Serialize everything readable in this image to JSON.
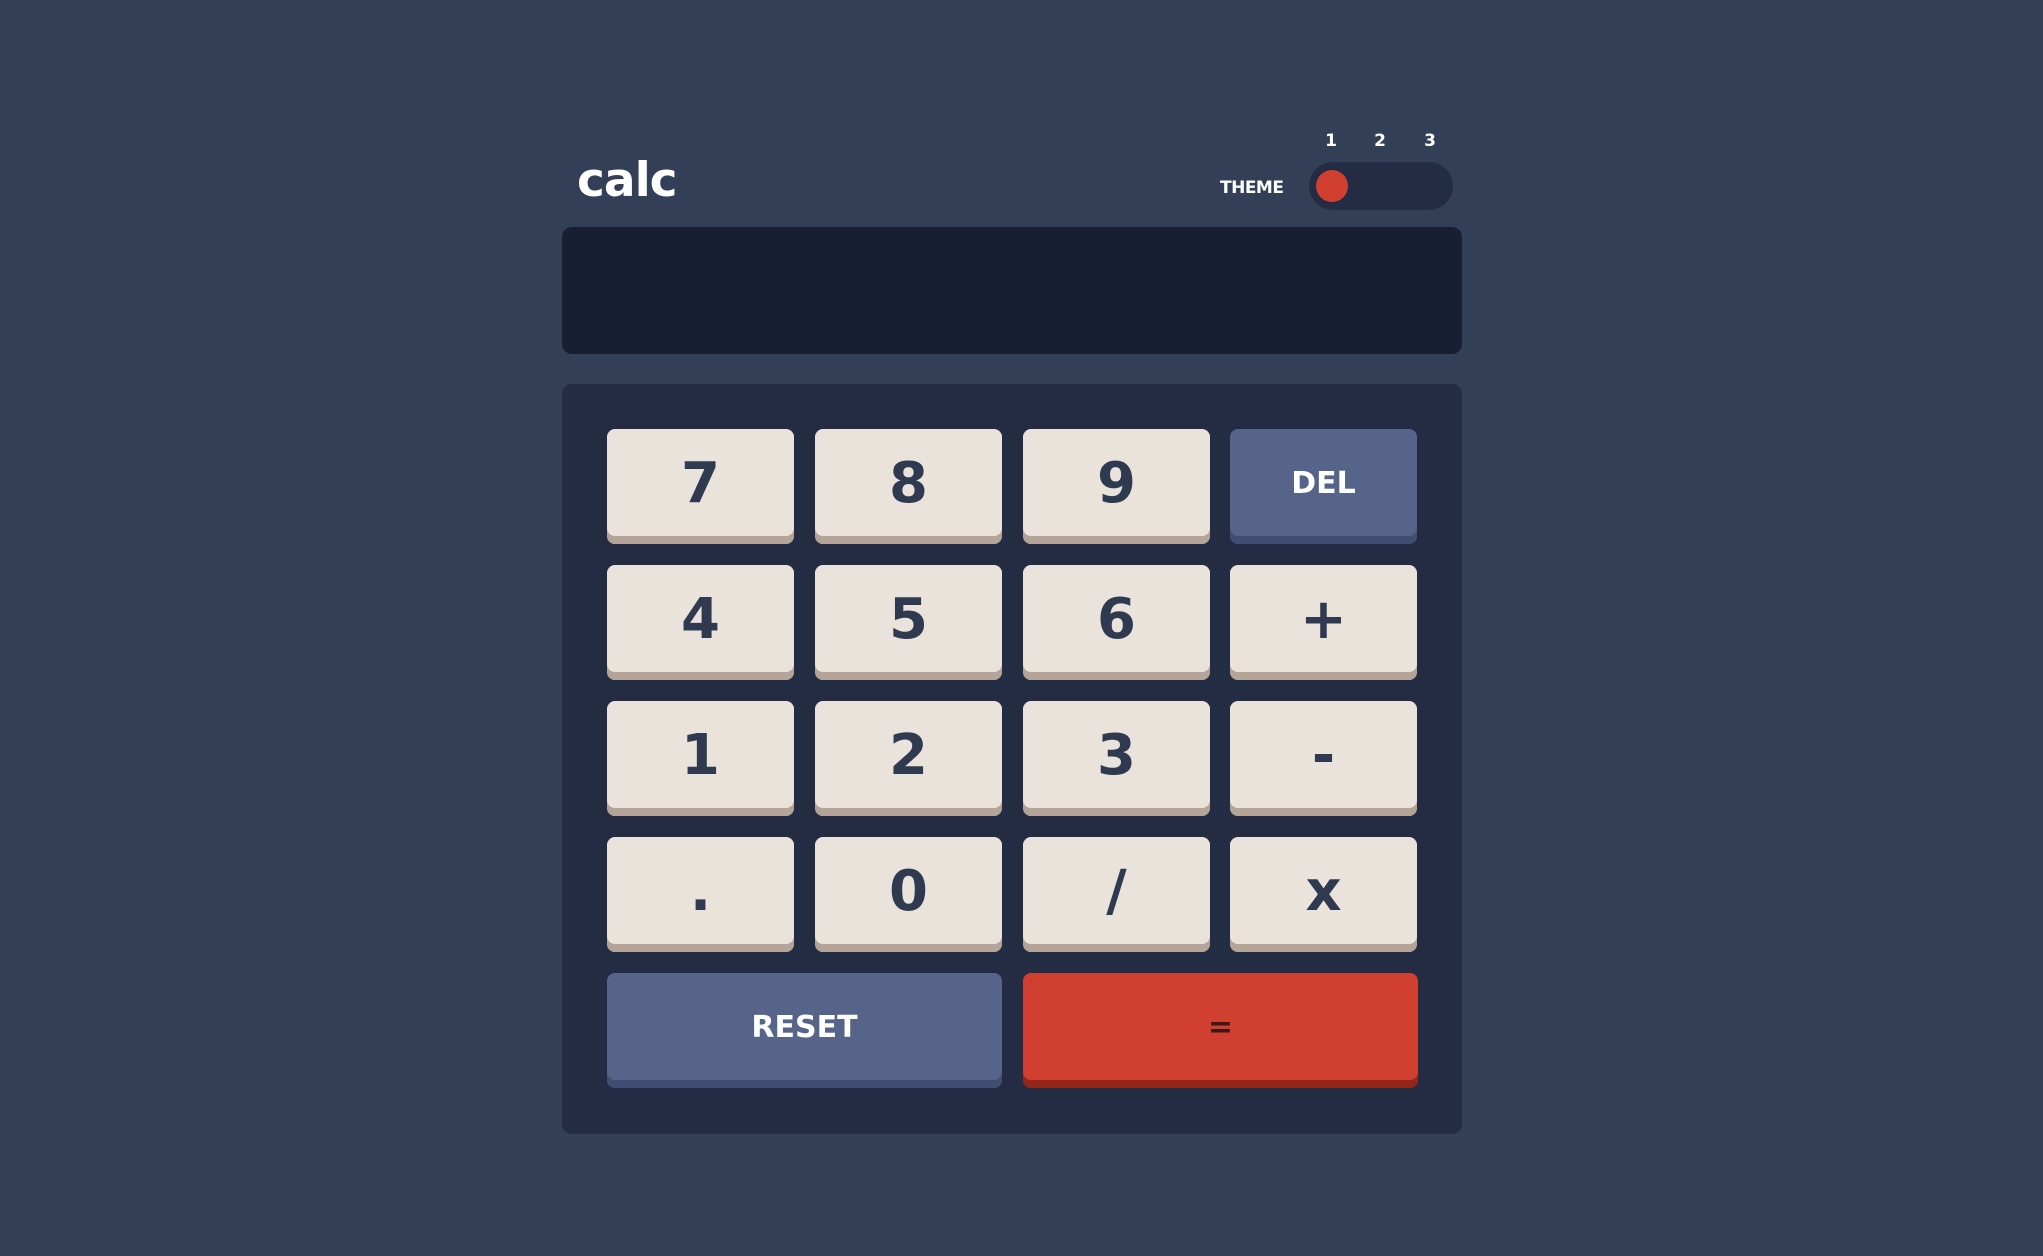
{
  "app": {
    "logo": "calc"
  },
  "theme": {
    "label": "THEME",
    "options": [
      "1",
      "2",
      "3"
    ],
    "selected": "1"
  },
  "display": {
    "value": ""
  },
  "keys": {
    "seven": "7",
    "eight": "8",
    "nine": "9",
    "del": "DEL",
    "four": "4",
    "five": "5",
    "six": "6",
    "plus": "+",
    "one": "1",
    "two": "2",
    "three": "3",
    "minus": "-",
    "dot": ".",
    "zero": "0",
    "divide": "/",
    "multiply": "x",
    "reset": "RESET",
    "equals": "="
  },
  "colors": {
    "background": "#333f57",
    "screen": "#181f32",
    "keypad": "#232c43",
    "key": "#eae3dc",
    "key_shadow": "#b3a497",
    "function_key": "#56648a",
    "accent": "#d03f2f"
  }
}
